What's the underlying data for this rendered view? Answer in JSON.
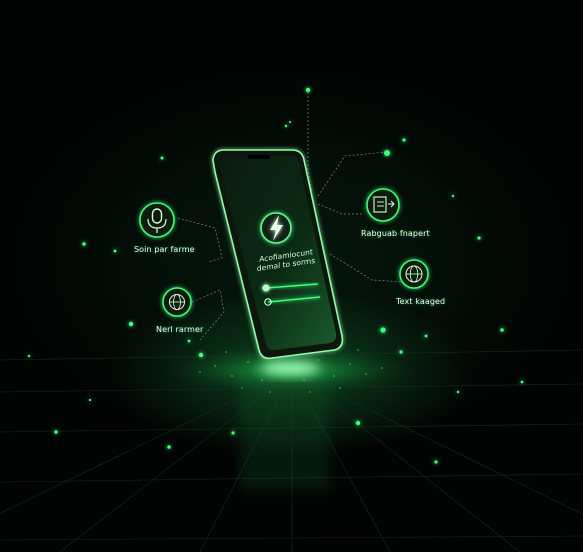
{
  "labels": {
    "left_top": "Soin par farme",
    "left_bottom": "Nerl rarmer",
    "right_top": "Rabguab fnapert",
    "right_bottom": "Text kaaged"
  },
  "phone": {
    "screen_line1": "Acofiamiocunt",
    "screen_line2": "demal to sorms"
  },
  "colors": {
    "accent": "#29ff6a",
    "glow": "#5bff8c",
    "background": "#020403"
  },
  "icons": [
    "microphone-icon",
    "globe-chat-icon",
    "file-transfer-icon",
    "globe-icon",
    "lightning-icon"
  ]
}
